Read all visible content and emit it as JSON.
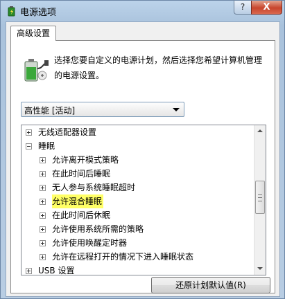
{
  "window": {
    "title": "电源选项",
    "help_label": "?",
    "close_label": "X"
  },
  "tabs": [
    {
      "label": "高级设置",
      "active": true
    }
  ],
  "description": "选择您要自定义的电源计划，然后选择您希望计算机管理的电源设置。",
  "plan_select": {
    "selected": "高性能 [活动]"
  },
  "tree": {
    "items": [
      {
        "label": "无线适配器设置",
        "level": 0,
        "expander": "plus",
        "highlighted": false
      },
      {
        "label": "睡眠",
        "level": 0,
        "expander": "minus",
        "highlighted": false
      },
      {
        "label": "允许离开模式策略",
        "level": 1,
        "expander": "plus",
        "highlighted": false
      },
      {
        "label": "在此时间后睡眠",
        "level": 1,
        "expander": "plus",
        "highlighted": false
      },
      {
        "label": "无人参与系统睡眠超时",
        "level": 1,
        "expander": "plus",
        "highlighted": false
      },
      {
        "label": "允许混合睡眠",
        "level": 1,
        "expander": "plus",
        "highlighted": true
      },
      {
        "label": "在此时间后休眠",
        "level": 1,
        "expander": "plus",
        "highlighted": false
      },
      {
        "label": "允许使用系统所需的策略",
        "level": 1,
        "expander": "plus",
        "highlighted": false
      },
      {
        "label": "允许使用唤醒定时器",
        "level": 1,
        "expander": "plus",
        "highlighted": false
      },
      {
        "label": "允许在远程打开的情况下进入睡眠状态",
        "level": 1,
        "expander": "plus",
        "highlighted": false
      },
      {
        "label": "USB 设置",
        "level": 0,
        "expander": "plus",
        "highlighted": false
      }
    ]
  },
  "buttons": {
    "restore_defaults": "还原计划默认值(R)"
  },
  "colors": {
    "highlight": "#ffff66",
    "close_button": "#c8452d",
    "title_bar": "#bcd3ea"
  }
}
